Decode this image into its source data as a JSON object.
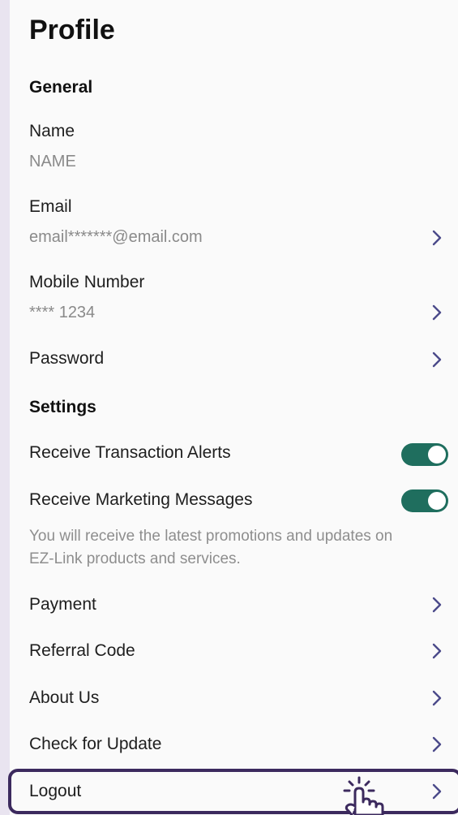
{
  "header": {
    "title": "Profile"
  },
  "general": {
    "heading": "General",
    "name": {
      "label": "Name",
      "value": "NAME"
    },
    "email": {
      "label": "Email",
      "value": "email*******@email.com"
    },
    "mobile": {
      "label": "Mobile Number",
      "value": "**** 1234"
    },
    "password": {
      "label": "Password"
    }
  },
  "settings": {
    "heading": "Settings",
    "transaction_alerts": {
      "label": "Receive Transaction Alerts",
      "on": true
    },
    "marketing_messages": {
      "label": "Receive Marketing Messages",
      "on": true
    },
    "marketing_note": "You will receive the latest promotions and updates on EZ-Link products and services."
  },
  "menu": {
    "payment": "Payment",
    "referral": "Referral Code",
    "about": "About Us",
    "update": "Check for Update",
    "logout": "Logout"
  },
  "colors": {
    "accent": "#3c2a5e",
    "toggle_on": "#1f6e5e",
    "chevron": "#4b4a8a"
  },
  "icons": {
    "chevron": "chevron-right-icon",
    "pointer": "hand-pointer-icon"
  }
}
